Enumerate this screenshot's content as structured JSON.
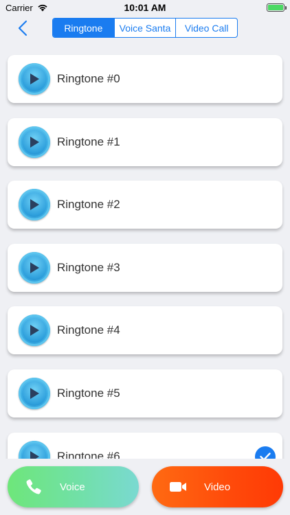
{
  "status_bar": {
    "carrier": "Carrier",
    "time": "10:01 AM"
  },
  "nav": {
    "back_icon": "chevron-left-icon",
    "tabs": [
      {
        "label": "Ringtone",
        "active": true
      },
      {
        "label": "Voice Santa",
        "active": false
      },
      {
        "label": "Video Call",
        "active": false
      }
    ]
  },
  "ringtones": [
    {
      "label": "Ringtone #0",
      "selected": false
    },
    {
      "label": "Ringtone #1",
      "selected": false
    },
    {
      "label": "Ringtone #2",
      "selected": false
    },
    {
      "label": "Ringtone #3",
      "selected": false
    },
    {
      "label": "Ringtone #4",
      "selected": false
    },
    {
      "label": "Ringtone #5",
      "selected": false
    },
    {
      "label": "Ringtone #6",
      "selected": true
    }
  ],
  "bottom": {
    "voice_label": "Voice",
    "video_label": "Video"
  },
  "colors": {
    "accent": "#1a7cf0",
    "background": "#eff0f4",
    "voice_gradient_start": "#6ee67a",
    "video_gradient_start": "#ff6a12"
  }
}
